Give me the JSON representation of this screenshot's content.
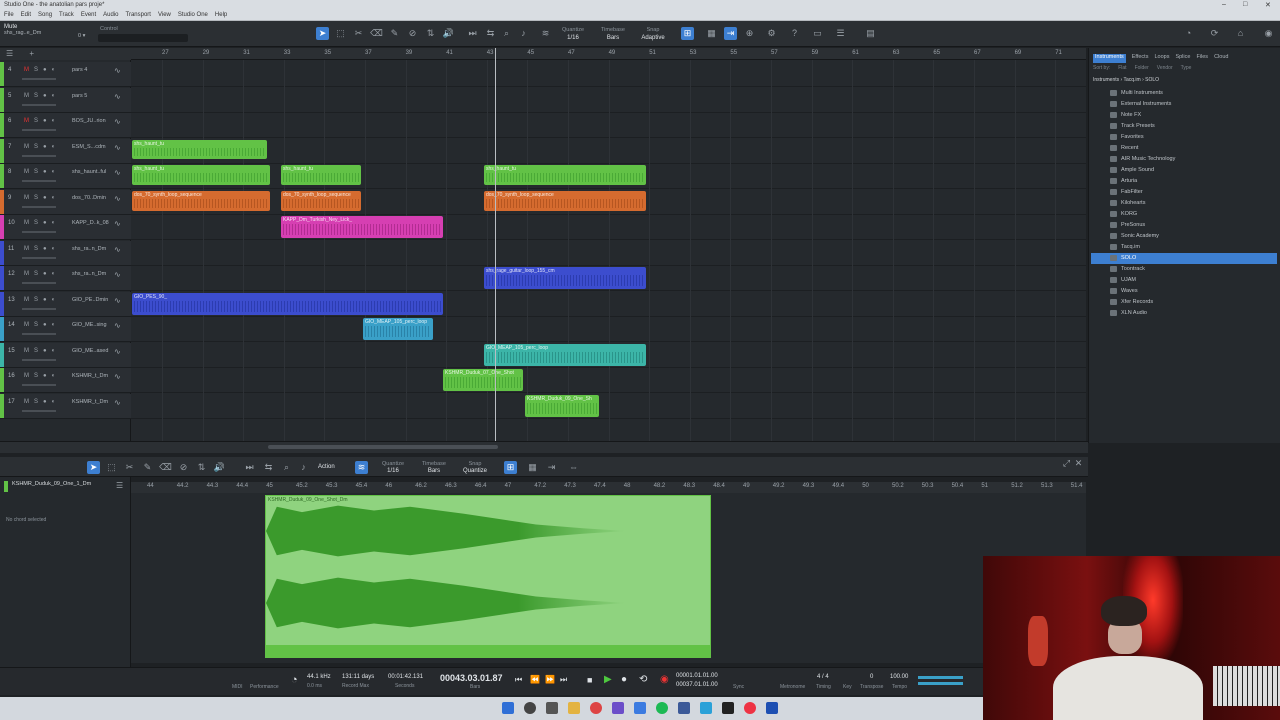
{
  "window": {
    "title": "Studio One - the anatolian pars proje*"
  },
  "menu": [
    "File",
    "Edit",
    "Song",
    "Track",
    "Event",
    "Audio",
    "Transport",
    "View",
    "Studio One",
    "Help"
  ],
  "inspector": {
    "label": "Mute",
    "track": "shs_rag..e_Dm",
    "value": "0 ▾",
    "control_label": "Control"
  },
  "toolbar": {
    "quantize_label": "Quantize",
    "quantize_value": "1/16",
    "timebase_label": "Timebase",
    "timebase_value": "Bars",
    "snap_label": "Snap",
    "snap_value": "Adaptive"
  },
  "ruler": [
    "27",
    "29",
    "31",
    "33",
    "35",
    "37",
    "39",
    "41",
    "43",
    "45",
    "47",
    "49",
    "51",
    "53",
    "55",
    "57",
    "59",
    "61",
    "63",
    "65",
    "67",
    "69",
    "71"
  ],
  "tracks": [
    {
      "num": "4",
      "name": "pars 4",
      "color": "#62c246",
      "mute": true
    },
    {
      "num": "5",
      "name": "pars 5",
      "color": "#62c246",
      "mute": false
    },
    {
      "num": "6",
      "name": "BOS_JU..rion",
      "color": "#62c246",
      "mute": true
    },
    {
      "num": "7",
      "name": "ESM_S...cdm",
      "color": "#62c246",
      "mute": false
    },
    {
      "num": "8",
      "name": "shs_haunt..ful",
      "color": "#62c246",
      "mute": false
    },
    {
      "num": "9",
      "name": "dos_70..Dmin",
      "color": "#d56b2f",
      "mute": false
    },
    {
      "num": "10",
      "name": "KAPP_D..k_08",
      "color": "#d63fb2",
      "mute": false
    },
    {
      "num": "11",
      "name": "shs_ra..n_Dm",
      "color": "#3c4dce",
      "mute": false
    },
    {
      "num": "12",
      "name": "shs_ra..n_Dm",
      "color": "#3c4dce",
      "mute": false
    },
    {
      "num": "13",
      "name": "GIO_PE..Dmin",
      "color": "#3c4dce",
      "mute": false
    },
    {
      "num": "14",
      "name": "GIO_ME..sing",
      "color": "#3aa0c8",
      "mute": false
    },
    {
      "num": "15",
      "name": "GIO_ME..ased",
      "color": "#3cb5a8",
      "mute": false
    },
    {
      "num": "16",
      "name": "KSHMR_t_Dm",
      "color": "#62c246",
      "mute": false
    },
    {
      "num": "17",
      "name": "KSHMR_t_Dm",
      "color": "#62c246",
      "mute": false
    }
  ],
  "clip_labels": {
    "haunt": "shs_haunt_tu",
    "loop": "dos_70_synth_loop_sequence",
    "kapp": "KAPP_Dm_Turkish_Ney_Lick_",
    "rage": "shs_rage_guitar_loop_155_cm",
    "pes": "GIO_PES_90_",
    "meap": "GIO_MEAP_105_perc_loop",
    "duduk07": "KSHMR_Duduk_07_One_Shot",
    "duduk09": "KSHMR_Duduk_09_One_Sh"
  },
  "browser": {
    "tabs": [
      "Instruments",
      "Effects",
      "Loops",
      "Splice",
      "Files",
      "Cloud"
    ],
    "sub": [
      "Sort by:",
      "Flat",
      "Folder",
      "Vendor",
      "Type"
    ],
    "breadcrumb": "Instruments  ›  Tacq.im  ›  SOLO",
    "items": [
      "Multi Instruments",
      "External Instruments",
      "Note FX",
      "Track Presets",
      "Favorites",
      "Recent",
      "AIR Music Technology",
      "Ample Sound",
      "Arturia",
      "FabFilter",
      "Kilohearts",
      "KORG",
      "PreSonus",
      "Sonic Academy",
      "Tacq.im",
      "SOLO",
      "Toontrack",
      "UJAM",
      "Waves",
      "Xfer Records",
      "XLN Audio"
    ],
    "selected": "SOLO"
  },
  "editor": {
    "action_label": "Action",
    "quantize_label": "Quantize",
    "quantize_value": "1/16",
    "timebase_label": "Timebase",
    "timebase_value": "Bars",
    "snap_label": "Snap",
    "snap_value": "Quantize",
    "clip_name": "KSHMR_Duduk_09_One_1_Dm",
    "no_chord": "No chord selected",
    "clip_title": "KSHMR_Duduk_09_One_Shot_Dm",
    "ruler": [
      "44",
      "44.2",
      "44.3",
      "44.4",
      "45",
      "45.2",
      "45.3",
      "45.4",
      "46",
      "46.2",
      "46.3",
      "46.4",
      "47",
      "47.2",
      "47.3",
      "47.4",
      "48",
      "48.2",
      "48.3",
      "48.4",
      "49",
      "49.2",
      "49.3",
      "49.4",
      "50",
      "50.2",
      "50.3",
      "50.4",
      "51",
      "51.2",
      "51.3",
      "51.4"
    ]
  },
  "transport": {
    "sample_rate": "44.1 kHz",
    "latency": "0.0 ms",
    "record_max": "131:11 days",
    "record_max_label": "Record Max",
    "seconds": "00:01:42.131",
    "seconds_label": "Seconds",
    "position": "00043.03.01.87",
    "position_label": "Bars",
    "loop_start": "00001.01.01.00",
    "loop_end": "00037.01.01.00",
    "signature": "4 / 4",
    "timing_label": "Timing",
    "key_label": "Key",
    "transpose": "0",
    "transpose_label": "Transpose",
    "tempo": "100.00",
    "tempo_label": "Tempo",
    "metronome_label": "Metronome",
    "sync_label": "Sync",
    "performance_label": "Performance",
    "midi_label": "MIDI"
  },
  "colors": {
    "accent": "#3d7fd1",
    "green": "#62c246",
    "orange": "#d56b2f",
    "pink": "#d63fb2",
    "blue": "#3c4dce",
    "lightblue": "#3aa0c8"
  }
}
